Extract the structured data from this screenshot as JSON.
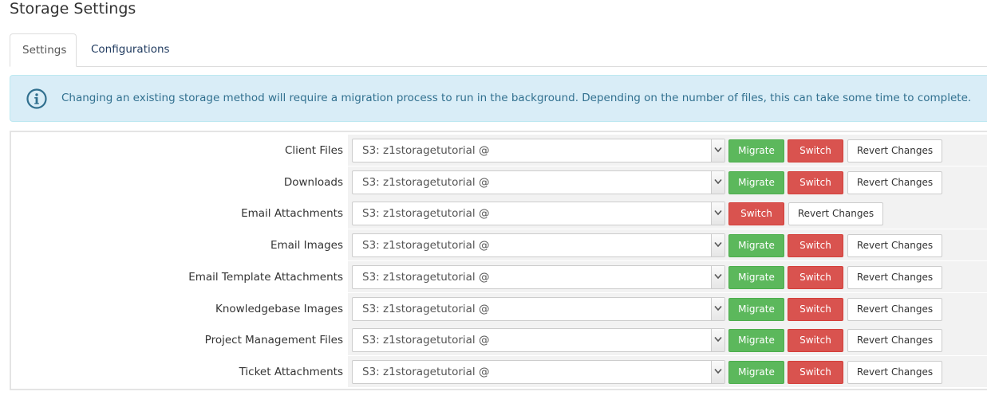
{
  "page": {
    "title": "Storage Settings"
  },
  "tabs": [
    {
      "label": "Settings",
      "active": true
    },
    {
      "label": "Configurations",
      "active": false
    }
  ],
  "alert": {
    "icon": "info-circle-icon",
    "text": "Changing an existing storage method will require a migration process to run in the background. Depending on the number of files, this can take some time to complete."
  },
  "colors": {
    "migrate": "#5cb85c",
    "switch": "#d9534f",
    "alert_bg": "#d9edf7",
    "alert_text": "#31708f"
  },
  "buttons": {
    "migrate_label": "Migrate",
    "switch_label": "Switch",
    "revert_label": "Revert Changes"
  },
  "rows": [
    {
      "label": "Client Files",
      "value": "S3: z1storagetutorial @",
      "has_migrate": true
    },
    {
      "label": "Downloads",
      "value": "S3: z1storagetutorial @",
      "has_migrate": true
    },
    {
      "label": "Email Attachments",
      "value": "S3: z1storagetutorial @",
      "has_migrate": false
    },
    {
      "label": "Email Images",
      "value": "S3: z1storagetutorial @",
      "has_migrate": true
    },
    {
      "label": "Email Template Attachments",
      "value": "S3: z1storagetutorial @",
      "has_migrate": true
    },
    {
      "label": "Knowledgebase Images",
      "value": "S3: z1storagetutorial @",
      "has_migrate": true
    },
    {
      "label": "Project Management Files",
      "value": "S3: z1storagetutorial @",
      "has_migrate": true
    },
    {
      "label": "Ticket Attachments",
      "value": "S3: z1storagetutorial @",
      "has_migrate": true
    }
  ]
}
